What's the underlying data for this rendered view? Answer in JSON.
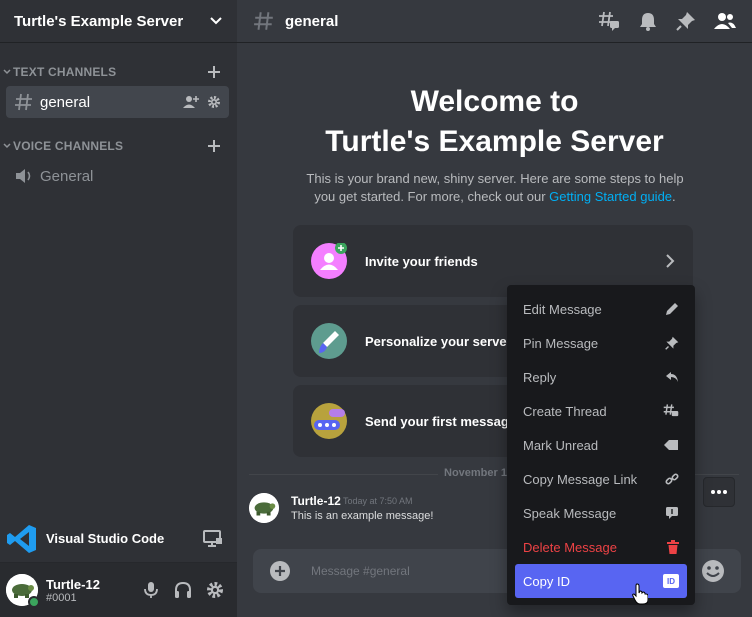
{
  "server": {
    "name": "Turtle's Example Server"
  },
  "sidebar": {
    "text_category": "TEXT CHANNELS",
    "voice_category": "VOICE CHANNELS",
    "text_channels": [
      {
        "label": "general",
        "active": true
      }
    ],
    "voice_channels": [
      {
        "label": "General"
      }
    ]
  },
  "activity": {
    "app_name": "Visual Studio Code"
  },
  "user": {
    "name": "Turtle-12",
    "tag": "#0001",
    "status_color": "#3ba55d"
  },
  "channel_header": {
    "title": "general"
  },
  "welcome": {
    "title_line1": "Welcome to",
    "title_line2": "Turtle's Example Server",
    "desc": "This is your brand new, shiny server. Here are some steps to help you get started. For more, check out our ",
    "link": "Getting Started guide",
    "desc_end": "."
  },
  "cards": [
    {
      "label": "Invite your friends",
      "icon": "invite-friends-icon",
      "color": "#f47fff"
    },
    {
      "label": "Personalize your server",
      "icon": "personalize-brush-icon",
      "color": "#5e9c8f"
    },
    {
      "label": "Send your first message",
      "icon": "first-message-icon",
      "color": "#b8a23d"
    }
  ],
  "divider": {
    "date": "November 1"
  },
  "message": {
    "author": "Turtle-12",
    "time": "Today at 7:50 AM",
    "text": "This is an example message!"
  },
  "composer": {
    "placeholder": "Message #general"
  },
  "context_menu": {
    "items": [
      {
        "label": "Edit Message",
        "icon": "pencil-icon"
      },
      {
        "label": "Pin Message",
        "icon": "pin-icon"
      },
      {
        "label": "Reply",
        "icon": "reply-icon"
      },
      {
        "label": "Create Thread",
        "icon": "thread-icon"
      },
      {
        "label": "Mark Unread",
        "icon": "mark-unread-icon"
      },
      {
        "label": "Copy Message Link",
        "icon": "link-icon"
      },
      {
        "label": "Speak Message",
        "icon": "speak-icon"
      },
      {
        "label": "Delete Message",
        "icon": "trash-icon",
        "danger": true
      },
      {
        "label": "Copy ID",
        "icon": "id-icon",
        "selected": true
      }
    ],
    "id_badge": "ID"
  },
  "colors": {
    "accent": "#5865f2",
    "danger": "#ed4245",
    "link": "#00aff4"
  }
}
